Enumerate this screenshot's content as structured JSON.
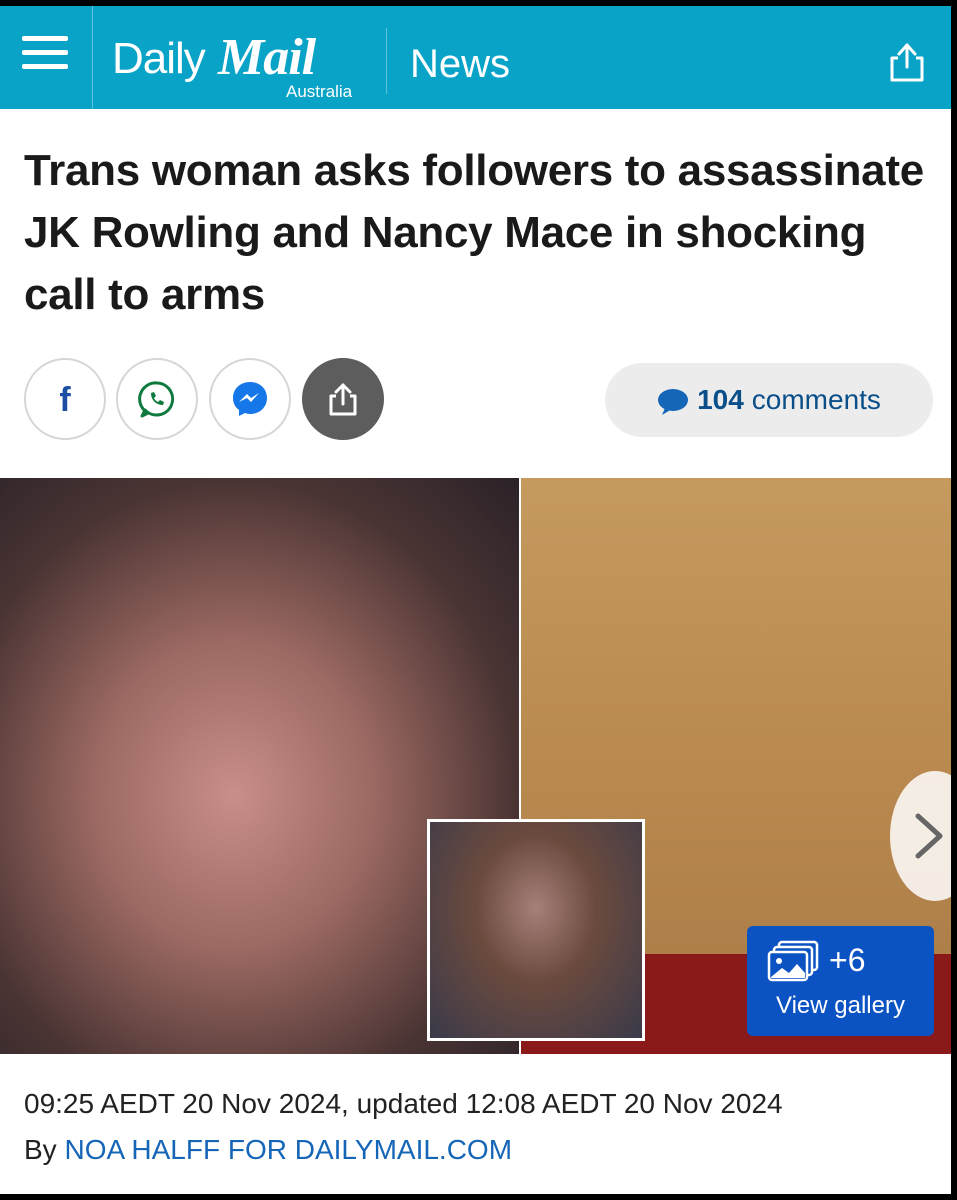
{
  "header": {
    "logo_daily": "Daily",
    "logo_mail": "Mail",
    "logo_sub": "Australia",
    "section": "News",
    "bg_color": "#0aa3c8"
  },
  "article": {
    "headline": "Trans woman asks followers to assassinate JK Rowling and Nancy Mace in shocking call to arms",
    "comments_count": "104",
    "comments_label": "comments",
    "gallery_count": "+6",
    "gallery_label": "View gallery",
    "timestamp": "09:25 AEDT 20 Nov 2024, updated 12:08 AEDT 20 Nov 2024",
    "byline_prefix": "By",
    "author": "NOA HALFF FOR DAILYMAIL.COM"
  },
  "share_buttons": [
    {
      "name": "facebook",
      "icon": "facebook-icon"
    },
    {
      "name": "whatsapp",
      "icon": "whatsapp-icon"
    },
    {
      "name": "messenger",
      "icon": "messenger-icon"
    },
    {
      "name": "share",
      "icon": "share-icon"
    }
  ],
  "colors": {
    "accent": "#0aa3c8",
    "link": "#1666b8",
    "gallery": "#0b52c2"
  }
}
